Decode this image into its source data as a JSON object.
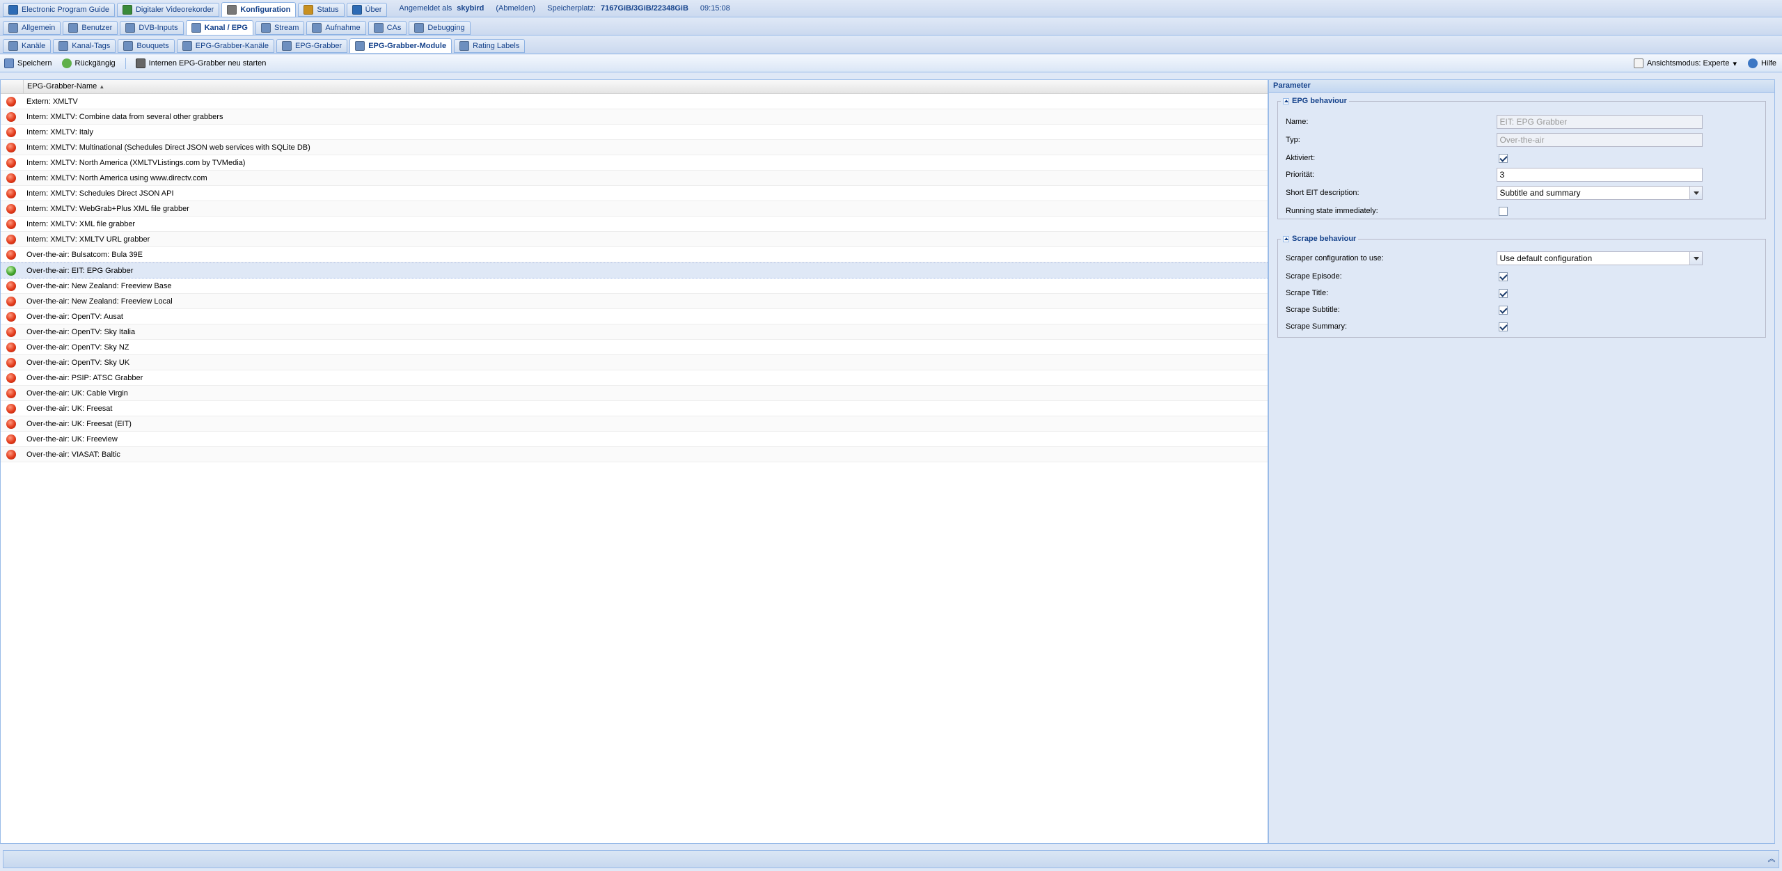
{
  "main_tabs": [
    {
      "label": "Electronic Program Guide",
      "icon": "epg-icon",
      "color": "#2d6bb5"
    },
    {
      "label": "Digitaler Videorekorder",
      "icon": "dvr-icon",
      "color": "#3a8a3a"
    },
    {
      "label": "Konfiguration",
      "icon": "wrench-icon",
      "color": "#777777",
      "active": true
    },
    {
      "label": "Status",
      "icon": "status-icon",
      "color": "#c89020"
    },
    {
      "label": "Über",
      "icon": "info-icon",
      "color": "#2d6bb5"
    }
  ],
  "session": {
    "logged_in_prefix": "Angemeldet als",
    "user": "skybird",
    "logout": "(Abmelden)",
    "storage_prefix": "Speicherplatz:",
    "storage": "7167GiB/3GiB/22348GiB",
    "time": "09:15:08"
  },
  "config_tabs": [
    {
      "label": "Allgemein",
      "icon": "wrench-icon"
    },
    {
      "label": "Benutzer",
      "icon": "users-icon"
    },
    {
      "label": "DVB-Inputs",
      "icon": "dvb-icon"
    },
    {
      "label": "Kanal / EPG",
      "icon": "tv-icon",
      "active": true
    },
    {
      "label": "Stream",
      "icon": "stream-icon"
    },
    {
      "label": "Aufnahme",
      "icon": "record-icon"
    },
    {
      "label": "CAs",
      "icon": "key-icon"
    },
    {
      "label": "Debugging",
      "icon": "debug-icon"
    }
  ],
  "sub_tabs": [
    {
      "label": "Kanäle",
      "icon": "channel-icon"
    },
    {
      "label": "Kanal-Tags",
      "icon": "tag-icon"
    },
    {
      "label": "Bouquets",
      "icon": "bouquet-icon"
    },
    {
      "label": "EPG-Grabber-Kanäle",
      "icon": "grabber-channels-icon"
    },
    {
      "label": "EPG-Grabber",
      "icon": "grabber-icon"
    },
    {
      "label": "EPG-Grabber-Module",
      "icon": "grabber-module-icon",
      "active": true
    },
    {
      "label": "Rating Labels",
      "icon": "rating-icon"
    }
  ],
  "toolbar": {
    "save": "Speichern",
    "undo": "Rückgängig",
    "restart": "Internen EPG-Grabber neu starten",
    "view_mode": "Ansichtsmodus: Experte",
    "help": "Hilfe"
  },
  "grid": {
    "column_header": "EPG-Grabber-Name",
    "rows": [
      {
        "name": "Extern: XMLTV",
        "enabled": false
      },
      {
        "name": "Intern: XMLTV: Combine data from several other grabbers",
        "enabled": false
      },
      {
        "name": "Intern: XMLTV: Italy",
        "enabled": false
      },
      {
        "name": "Intern: XMLTV: Multinational (Schedules Direct JSON web services with SQLite DB)",
        "enabled": false
      },
      {
        "name": "Intern: XMLTV: North America (XMLTVListings.com by TVMedia)",
        "enabled": false
      },
      {
        "name": "Intern: XMLTV: North America using www.directv.com",
        "enabled": false
      },
      {
        "name": "Intern: XMLTV: Schedules Direct JSON API",
        "enabled": false
      },
      {
        "name": "Intern: XMLTV: WebGrab+Plus XML file grabber",
        "enabled": false
      },
      {
        "name": "Intern: XMLTV: XML file grabber",
        "enabled": false
      },
      {
        "name": "Intern: XMLTV: XMLTV URL grabber",
        "enabled": false
      },
      {
        "name": "Over-the-air: Bulsatcom: Bula 39E",
        "enabled": false
      },
      {
        "name": "Over-the-air: EIT: EPG Grabber",
        "enabled": true,
        "selected": true
      },
      {
        "name": "Over-the-air: New Zealand: Freeview Base",
        "enabled": false
      },
      {
        "name": "Over-the-air: New Zealand: Freeview Local",
        "enabled": false
      },
      {
        "name": "Over-the-air: OpenTV: Ausat",
        "enabled": false
      },
      {
        "name": "Over-the-air: OpenTV: Sky Italia",
        "enabled": false
      },
      {
        "name": "Over-the-air: OpenTV: Sky NZ",
        "enabled": false
      },
      {
        "name": "Over-the-air: OpenTV: Sky UK",
        "enabled": false
      },
      {
        "name": "Over-the-air: PSIP: ATSC Grabber",
        "enabled": false
      },
      {
        "name": "Over-the-air: UK: Cable Virgin",
        "enabled": false
      },
      {
        "name": "Over-the-air: UK: Freesat",
        "enabled": false
      },
      {
        "name": "Over-the-air: UK: Freesat (EIT)",
        "enabled": false
      },
      {
        "name": "Over-the-air: UK: Freeview",
        "enabled": false
      },
      {
        "name": "Over-the-air: VIASAT: Baltic",
        "enabled": false
      }
    ]
  },
  "param": {
    "title": "Parameter",
    "epg_section": "EPG behaviour",
    "name_label": "Name:",
    "name_value": "EIT: EPG Grabber",
    "type_label": "Typ:",
    "type_value": "Over-the-air",
    "enabled_label": "Aktiviert:",
    "enabled": true,
    "priority_label": "Priorität:",
    "priority_value": "3",
    "short_eit_label": "Short EIT description:",
    "short_eit_value": "Subtitle and summary",
    "running_label": "Running state immediately:",
    "running": false,
    "scrape_section": "Scrape behaviour",
    "scraper_label": "Scraper configuration to use:",
    "scraper_value": "Use default configuration",
    "episode_label": "Scrape Episode:",
    "episode": true,
    "title_label": "Scrape Title:",
    "title_on": true,
    "subtitle_label": "Scrape Subtitle:",
    "subtitle": true,
    "summary_label": "Scrape Summary:",
    "summary": true
  }
}
